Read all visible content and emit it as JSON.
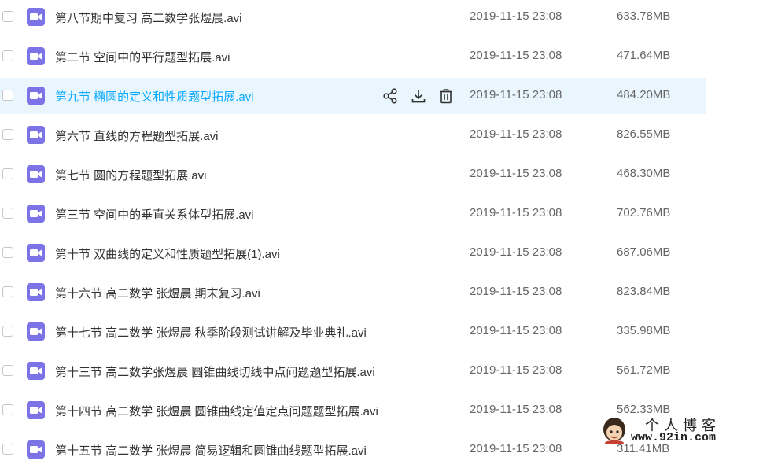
{
  "files": [
    {
      "name": "第八节期中复习 高二数学张煜晨.avi",
      "date": "2019-11-15 23:08",
      "size": "633.78MB"
    },
    {
      "name": "第二节 空间中的平行题型拓展.avi",
      "date": "2019-11-15 23:08",
      "size": "471.64MB"
    },
    {
      "name": "第九节 椭圆的定义和性质题型拓展.avi",
      "date": "2019-11-15 23:08",
      "size": "484.20MB"
    },
    {
      "name": "第六节 直线的方程题型拓展.avi",
      "date": "2019-11-15 23:08",
      "size": "826.55MB"
    },
    {
      "name": "第七节 圆的方程题型拓展.avi",
      "date": "2019-11-15 23:08",
      "size": "468.30MB"
    },
    {
      "name": "第三节 空间中的垂直关系体型拓展.avi",
      "date": "2019-11-15 23:08",
      "size": "702.76MB"
    },
    {
      "name": "第十节 双曲线的定义和性质题型拓展(1).avi",
      "date": "2019-11-15 23:08",
      "size": "687.06MB"
    },
    {
      "name": "第十六节 高二数学 张煜晨 期末复习.avi",
      "date": "2019-11-15 23:08",
      "size": "823.84MB"
    },
    {
      "name": "第十七节 高二数学 张煜晨 秋季阶段测试讲解及毕业典礼.avi",
      "date": "2019-11-15 23:08",
      "size": "335.98MB"
    },
    {
      "name": "第十三节 高二数学张煜晨 圆锥曲线切线中点问题题型拓展.avi",
      "date": "2019-11-15 23:08",
      "size": "561.72MB"
    },
    {
      "name": "第十四节 高二数学 张煜晨 圆锥曲线定值定点问题题型拓展.avi",
      "date": "2019-11-15 23:08",
      "size": "562.33MB"
    },
    {
      "name": "第十五节 高二数学 张煜晨 简易逻辑和圆锥曲线题型拓展.avi",
      "date": "2019-11-15 23:08",
      "size": "311.41MB"
    }
  ],
  "hovered_row": 2,
  "row_actions": [
    "share-icon",
    "download-icon",
    "delete-icon"
  ],
  "watermark": {
    "title": "个人博客",
    "url": "www.92in.com"
  },
  "colors": {
    "accent": "#06a7ff",
    "hover_bg": "#e9f6fd",
    "video_icon": "#7b73e6"
  }
}
